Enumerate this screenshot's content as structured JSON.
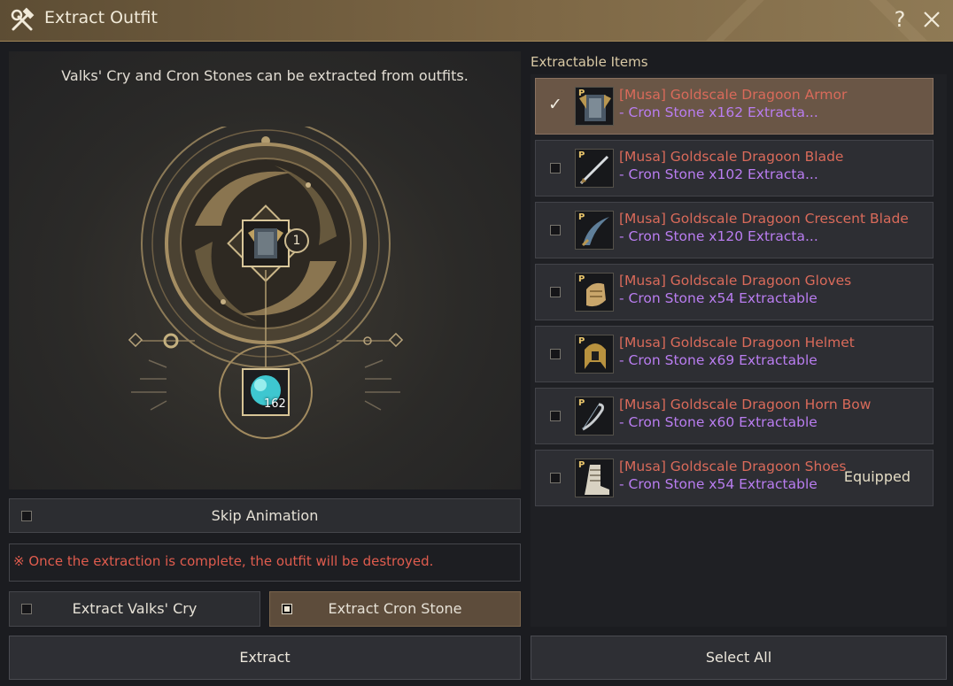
{
  "window": {
    "title": "Extract Outfit",
    "help_icon": "?",
    "title_icon": "hammer-wrench-icon",
    "close_icon": "close-icon"
  },
  "left": {
    "intro": "Valks' Cry and Cron Stones can be extracted from outfits.",
    "outfit_count": "1",
    "cron_stone_count": "162"
  },
  "options": {
    "skip_animation_label": "Skip Animation",
    "skip_animation_checked": false,
    "warning": "※ Once the extraction is complete, the outfit will be destroyed.",
    "extract_valks_label": "Extract Valks' Cry",
    "extract_valks_checked": false,
    "extract_cron_label": "Extract Cron Stone",
    "extract_cron_checked": true
  },
  "list": {
    "header": "Extractable Items",
    "items": [
      {
        "name": "[Musa] Goldscale Dragoon Armor",
        "sub": "- Cron Stone x162 Extracta...",
        "checked": true,
        "equipped": "",
        "icon": "armor-icon"
      },
      {
        "name": "[Musa] Goldscale Dragoon Blade",
        "sub": "- Cron Stone x102 Extracta...",
        "checked": false,
        "equipped": "",
        "icon": "blade-icon"
      },
      {
        "name": "[Musa] Goldscale Dragoon Crescent Blade",
        "sub": "- Cron Stone x120 Extracta...",
        "checked": false,
        "equipped": "",
        "icon": "crescent-blade-icon"
      },
      {
        "name": "[Musa] Goldscale Dragoon Gloves",
        "sub": "- Cron Stone x54 Extractable",
        "checked": false,
        "equipped": "",
        "icon": "gloves-icon"
      },
      {
        "name": "[Musa] Goldscale Dragoon Helmet",
        "sub": "- Cron Stone x69 Extractable",
        "checked": false,
        "equipped": "",
        "icon": "helmet-icon"
      },
      {
        "name": "[Musa] Goldscale Dragoon Horn Bow",
        "sub": "- Cron Stone x60 Extractable",
        "checked": false,
        "equipped": "",
        "icon": "horn-bow-icon"
      },
      {
        "name": "[Musa] Goldscale Dragoon Shoes",
        "sub": "- Cron Stone x54 Extractable",
        "checked": false,
        "equipped": "Equipped",
        "icon": "shoes-icon"
      }
    ],
    "item_grade_letter": "P"
  },
  "buttons": {
    "extract": "Extract",
    "select_all": "Select All"
  },
  "colors": {
    "title_bar": "#7d6745",
    "item_name": "#d96a5a",
    "item_sub": "#b97df0",
    "warning": "#e05c4e",
    "selected_row": "#6a5646"
  }
}
